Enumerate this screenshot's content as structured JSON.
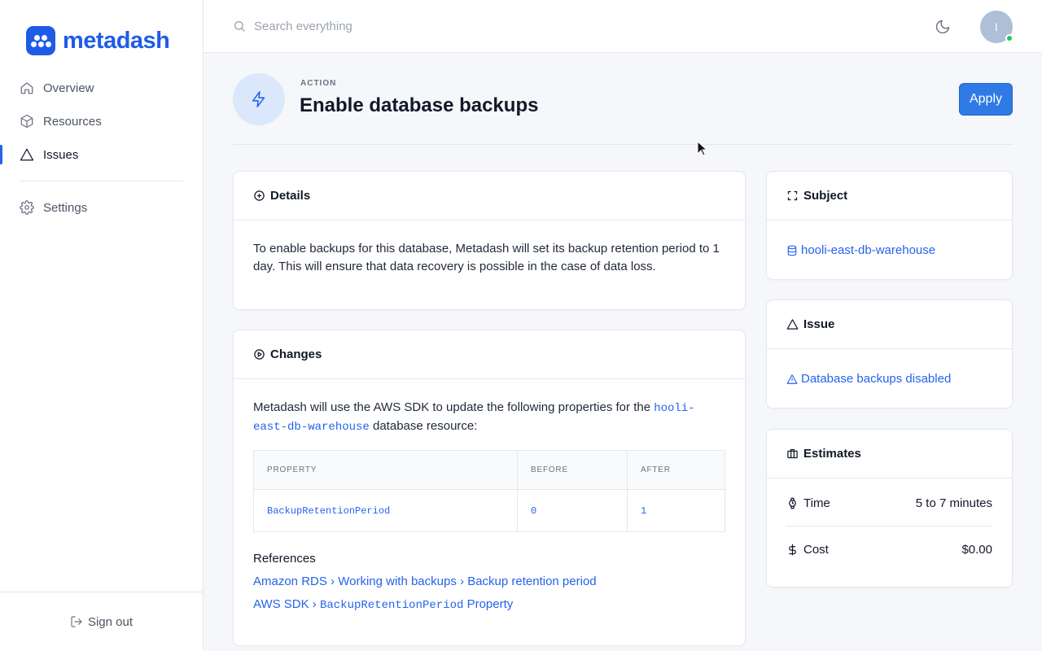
{
  "app": {
    "name": "metadash"
  },
  "sidebar": {
    "items": [
      {
        "label": "Overview",
        "icon": "home-icon"
      },
      {
        "label": "Resources",
        "icon": "cube-icon"
      },
      {
        "label": "Issues",
        "icon": "triangle-icon",
        "active": true
      },
      {
        "label": "Settings",
        "icon": "gear-icon"
      }
    ],
    "signout_label": "Sign out"
  },
  "topbar": {
    "search_placeholder": "Search everything",
    "avatar_initial": "I",
    "theme_icon": "moon-icon"
  },
  "header": {
    "eyebrow": "ACTION",
    "title": "Enable database backups",
    "apply_label": "Apply"
  },
  "details": {
    "title": "Details",
    "text": "To enable backups for this database, Metadash will set its backup retention period to 1 day. This will ensure that data recovery is possible in the case of data loss."
  },
  "changes": {
    "title": "Changes",
    "intro_before": "Metadash will use the AWS SDK to update the following properties for the ",
    "resource": "hooli-east-db-warehouse",
    "intro_after": " database resource:",
    "columns": [
      "PROPERTY",
      "BEFORE",
      "AFTER"
    ],
    "rows": [
      {
        "property": "BackupRetentionPeriod",
        "before": "0",
        "after": "1"
      }
    ],
    "references_title": "References",
    "references": {
      "ref1": [
        "Amazon RDS",
        "Working with backups",
        "Backup retention period"
      ],
      "ref2_prefix": "AWS SDK",
      "ref2_code": "BackupRetentionPeriod",
      "ref2_suffix": " Property",
      "separator": "›"
    }
  },
  "subject": {
    "title": "Subject",
    "resource": "hooli-east-db-warehouse"
  },
  "issue": {
    "title": "Issue",
    "label": "Database backups disabled"
  },
  "estimates": {
    "title": "Estimates",
    "time_label": "Time",
    "time_value": "5 to 7 minutes",
    "cost_label": "Cost",
    "cost_value": "$0.00"
  },
  "colors": {
    "brand": "#1f5ce6",
    "link": "#2563eb",
    "apply": "#2f7ae5",
    "online": "#22c55e"
  }
}
